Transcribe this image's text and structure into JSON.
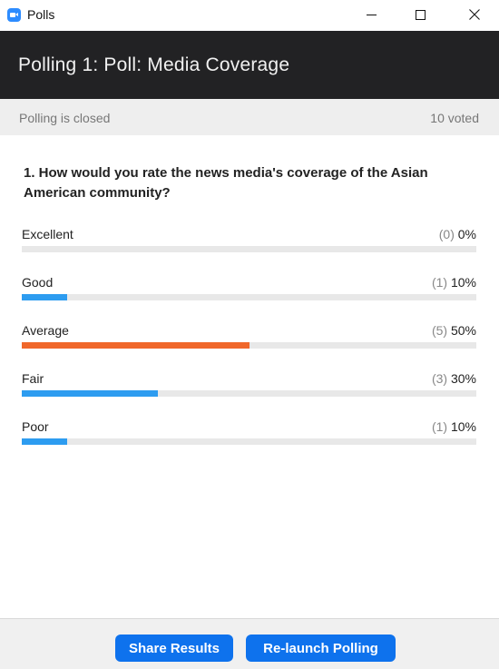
{
  "window": {
    "title": "Polls",
    "icon": "zoom-camera-icon"
  },
  "header": {
    "title": "Polling 1: Poll: Media Coverage"
  },
  "status": {
    "state": "Polling is closed",
    "voted": "10 voted"
  },
  "question": {
    "text": "1. How would you rate the news media's coverage of the Asian American community?"
  },
  "options": [
    {
      "label": "Excellent",
      "count": "(0)",
      "percent": "0%",
      "fraction": 0.0,
      "color": "#2d9cf0"
    },
    {
      "label": "Good",
      "count": "(1)",
      "percent": "10%",
      "fraction": 0.1,
      "color": "#2d9cf0"
    },
    {
      "label": "Average",
      "count": "(5)",
      "percent": "50%",
      "fraction": 0.5,
      "color": "#f0672a"
    },
    {
      "label": "Fair",
      "count": "(3)",
      "percent": "30%",
      "fraction": 0.3,
      "color": "#2d9cf0"
    },
    {
      "label": "Poor",
      "count": "(1)",
      "percent": "10%",
      "fraction": 0.1,
      "color": "#2d9cf0"
    }
  ],
  "footer": {
    "share_label": "Share Results",
    "relaunch_label": "Re-launch Polling"
  },
  "colors": {
    "header_bg": "#222224",
    "primary_button": "#0e72ed",
    "bar_default": "#2d9cf0",
    "bar_highlight": "#f0672a"
  }
}
